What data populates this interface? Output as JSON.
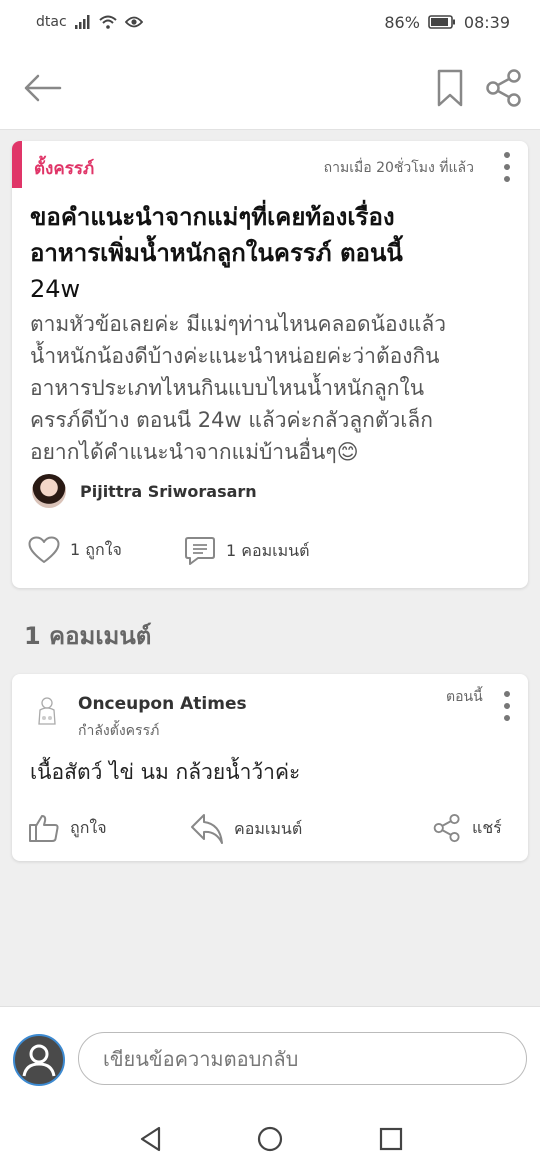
{
  "status_bar": {
    "carrier": "dtac",
    "battery": "86%",
    "time": "08:39"
  },
  "top_bar": {
    "back_icon": "arrow-left-icon",
    "bookmark_icon": "bookmark-icon",
    "share_icon": "share-icon"
  },
  "question": {
    "category": "ตั้งครรภ์",
    "asked_time": "ถามเมื่อ 20ชั่วโมง ที่แล้ว",
    "title_lines": [
      "ขอคำแนะนำจากแม่ๆที่เคยท้องเรื่อง",
      "อาหารเพิ่มน้ำหนักลูกในครรภ์ ตอนนี้",
      "24w"
    ],
    "body_lines": [
      "ตามหัวข้อเลยค่ะ มีแม่ๆท่านไหนคลอดน้องแล้ว",
      "น้ำหนักน้องดีบ้างค่ะแนะนำหน่อยค่ะว่าต้องกิน",
      "อาหารประเภทไหนกินแบบไหนน้ำหนักลูกใน",
      "ครรภ์ดีบ้าง ตอนนี 24w แล้วค่ะกลัวลูกตัวเล็ก",
      "อยากได้คำแนะนำจากแม่บ้านอื่นๆ😊"
    ],
    "author": "Pijittra Sriworasarn",
    "likes_label": "1 ถูกใจ",
    "comments_label": "1 คอมเมนต์"
  },
  "comments_heading": "1 คอมเมนต์",
  "comment": {
    "author": "Onceupon Atimes",
    "status": "กำลังตั้งครรภ์",
    "time": "ตอนนี้",
    "text": "เนื้อสัตว์ ไข่ นม กล้วยน้ำว้าค่ะ",
    "like_label": "ถูกใจ",
    "reply_label": "คอมเมนต์",
    "share_label": "แชร์"
  },
  "reply_bar": {
    "placeholder": "เขียนข้อความตอบกลับ"
  },
  "colors": {
    "accent": "#e03568",
    "background": "#efefef",
    "icon": "#777777"
  }
}
